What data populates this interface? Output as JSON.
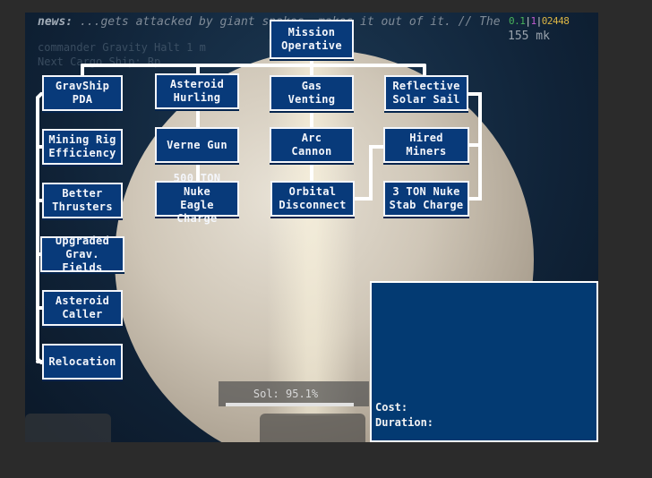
{
  "ticker": {
    "prefix": "news:",
    "text": "...gets attacked by giant snakes, makes it out of it. // The same an"
  },
  "ghost_lines": [
    "commander  Gravity  Halt 1 m",
    "Next Cargo Ship: Rp"
  ],
  "hud": {
    "fps_parts": [
      "0.1",
      "|",
      "1",
      "|",
      "0",
      "2448"
    ],
    "distance": "155 mk"
  },
  "tree": {
    "root": "Mission\nOperative",
    "col1": [
      "GravShip\nPDA",
      "Mining Rig\nEfficiency",
      "Better\nThrusters",
      "Upgraded\nGrav. Fields",
      "Asteroid\nCaller",
      "Relocation"
    ],
    "col2": [
      "Asteroid\nHurling",
      "Verne Gun",
      "500 TON Nuke\nEagle Charge"
    ],
    "col3": [
      "Gas\nVenting",
      "Arc\nCannon",
      "Orbital\nDisconnect"
    ],
    "col4": [
      "Reflective\nSolar Sail",
      "Hired\nMiners",
      "3 TON Nuke\nStab Charge"
    ]
  },
  "status": {
    "sol_label": "Sol: 95.1%",
    "sol_value": 95.1
  },
  "info_panel": {
    "cost_label": "Cost:",
    "duration_label": "Duration:"
  }
}
